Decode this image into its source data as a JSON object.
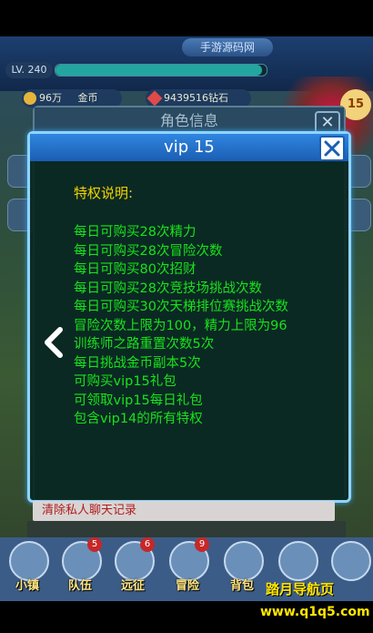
{
  "top_watermark": "手游源码网",
  "hud": {
    "level": "LV. 240",
    "exp_fill": 0.98,
    "gold_amount": "96万",
    "gold_label": "金币",
    "diamond_amount": "9439516",
    "diamond_label": "钻石",
    "vip_level": "15"
  },
  "role_dialog": {
    "title": "角色信息"
  },
  "vip_dialog": {
    "title": "vip 15",
    "privilege_heading": "特权说明:",
    "benefits": [
      "每日可购买28次精力",
      "每日可购买28次冒险次数",
      "每日可购买80次招财",
      "每日可购买28次竞技场挑战次数",
      "每日可购买30次天梯排位赛挑战次数",
      "冒险次数上限为100，精力上限为96",
      "训练师之路重置次数5次",
      "每日挑战金币副本5次",
      "可购买vip15礼包",
      "可领取vip15每日礼包",
      "包含vip14的所有特权"
    ]
  },
  "clear_chat_label": "清除私人聊天记录",
  "bottom_menu": [
    {
      "label": "小镇",
      "badge": ""
    },
    {
      "label": "队伍",
      "badge": "5"
    },
    {
      "label": "远征",
      "badge": "6"
    },
    {
      "label": "冒险",
      "badge": "9"
    },
    {
      "label": "背包",
      "badge": ""
    },
    {
      "label": "",
      "badge": ""
    },
    {
      "label": "",
      "badge": ""
    }
  ],
  "site_watermark": {
    "name": "踏月导航页",
    "url": "www.q1q5.com"
  },
  "colors": {
    "benefit_text": "#19e21b",
    "heading_text": "#f0d400",
    "dialog_border": "#8fd4ff",
    "header_blue": "#1b5eb3"
  }
}
